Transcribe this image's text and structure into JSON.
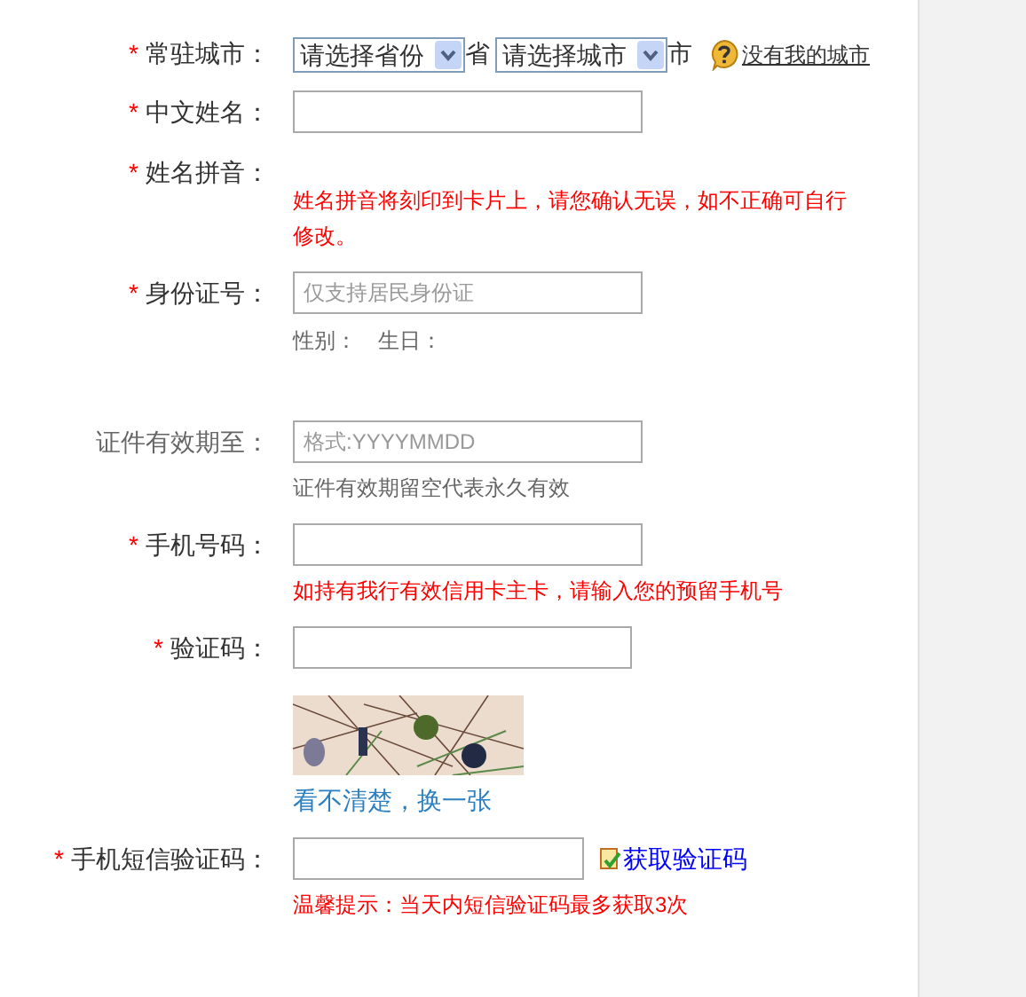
{
  "form": {
    "fields": [
      {
        "kind": "city",
        "label": "常驻城市：",
        "marker": "*",
        "province": {
          "value": "请选择省份"
        },
        "province_unit": "省",
        "city": {
          "value": "请选择城市"
        },
        "city_unit": "市",
        "link": "没有我的城市"
      },
      {
        "kind": "text",
        "label": "中文姓名：",
        "marker": "*"
      },
      {
        "kind": "note",
        "label": "姓名拼音：",
        "marker": "*",
        "hint": {
          "text": "姓名拼音将刻印到卡片上，请您确认无误，如不正确可自行修改。",
          "color": "#ff0000"
        }
      },
      {
        "kind": "text",
        "label": "身份证号：",
        "marker": "*",
        "placeholder": "仅支持居民身份证",
        "extra": [
          "性别：",
          "生日："
        ]
      },
      {
        "kind": "text",
        "label": "证件有效期至：",
        "placeholder": "格式:YYYYMMDD",
        "hint": {
          "text": "证件有效期留空代表永久有效",
          "color": "#666666"
        }
      },
      {
        "kind": "text",
        "label": "手机号码：",
        "marker": "*",
        "hint": {
          "text": "如持有我行有效信用卡主卡，请输入您的预留手机号",
          "color": "#ff0000"
        }
      },
      {
        "kind": "captcha",
        "label": "验证码：",
        "marker": "*",
        "link": "看不清楚，换一张"
      },
      {
        "kind": "sms",
        "label": "手机短信验证码：",
        "marker": "*",
        "button": "获取验证码",
        "hint": {
          "text": "温馨提示：当天内短信验证码最多获取3次",
          "color": "#ff0000"
        }
      }
    ]
  }
}
